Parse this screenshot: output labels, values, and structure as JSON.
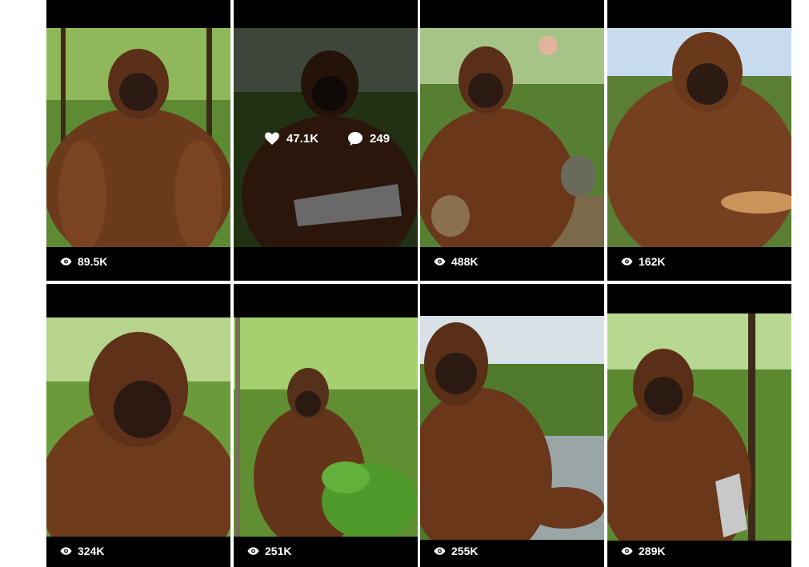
{
  "videos": [
    {
      "views": "89.5K"
    },
    {
      "views": "",
      "likes": "47.1K",
      "comments": "249"
    },
    {
      "views": "488K"
    },
    {
      "views": "162K"
    },
    {
      "views": "324K"
    },
    {
      "views": "251K"
    },
    {
      "views": "255K"
    },
    {
      "views": "289K"
    }
  ],
  "icons": {
    "views": "eye-icon",
    "likes": "heart-icon",
    "comments": "comment-bubble-icon"
  },
  "colors": {
    "tile_background": "#000000",
    "fur": "#6b3a1d",
    "forest": "#4f7a2e"
  }
}
